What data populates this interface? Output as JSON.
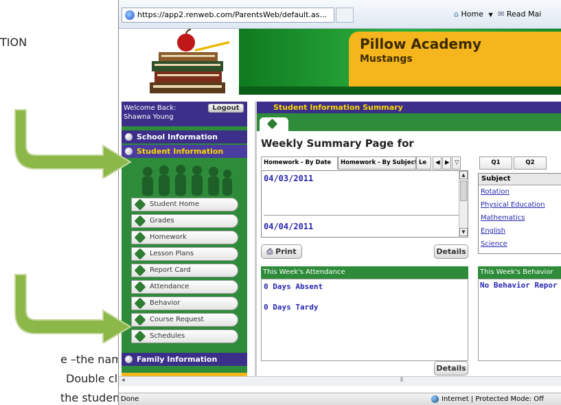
{
  "document": {
    "text_top": "TION",
    "text_bottom_1": "e –the names",
    "text_bottom_2": "Double click",
    "text_bottom_3": "the student's"
  },
  "browser": {
    "url": "https://app2.renweb.com/ParentsWeb/default.as...",
    "home_label": "Home",
    "read_mail_label": "Read Mai"
  },
  "banner": {
    "school_name": "Pillow Academy",
    "mascot": "Mustangs"
  },
  "sidebar": {
    "welcome_label": "Welcome Back:",
    "user_name": "Shawna Young",
    "logout_label": "Logout",
    "school_info": "School Information",
    "student_info": "Student Information",
    "items": [
      {
        "label": "Student Home"
      },
      {
        "label": "Grades"
      },
      {
        "label": "Homework"
      },
      {
        "label": "Lesson Plans"
      },
      {
        "label": "Report Card"
      },
      {
        "label": "Attendance"
      },
      {
        "label": "Behavior"
      },
      {
        "label": "Course Request"
      },
      {
        "label": "Schedules"
      }
    ],
    "family_info": "Family Information"
  },
  "main": {
    "summary_title": "Student Information Summary",
    "weekly_title": "Weekly Summary Page for",
    "tabs": [
      "Homework - By Date",
      "Homework - By Subject",
      "Le"
    ],
    "dates": [
      "04/03/2011",
      "04/04/2011"
    ],
    "print_label": "Print",
    "details_label": "Details",
    "attendance_header": "This Week's Attendance",
    "days_absent": "0 Days Absent",
    "days_tardy": "0 Days Tardy",
    "quarter_tabs": [
      "Q1",
      "Q2"
    ],
    "subject_header": "Subject",
    "subjects": [
      "Rotation",
      "Physical Education",
      "Mathematics",
      "English",
      "Science"
    ],
    "behavior_header": "This Week's Behavior",
    "behavior_text": "No Behavior Repor"
  },
  "status": {
    "left": "Done",
    "zone": "Internet | Protected Mode: Off"
  },
  "colors": {
    "nav_purple": "#3c2f8a",
    "nav_green": "#2d8b3a",
    "accent_yellow": "#ffd800",
    "banner_gold": "#f5b51c",
    "link_blue": "#2626b0"
  }
}
